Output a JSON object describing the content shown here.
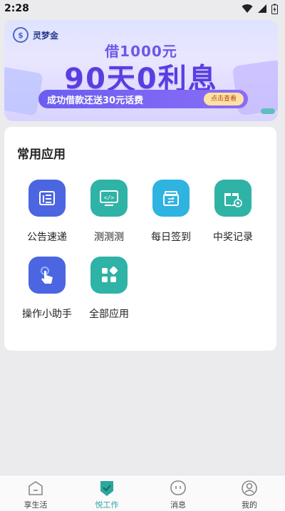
{
  "status_bar": {
    "time": "2:28"
  },
  "banner": {
    "brand": "灵梦金",
    "line1": "借1000元",
    "line2": "90天0利息",
    "promo_text": "成功借款还送30元话费",
    "promo_button": "点击查看"
  },
  "apps_section": {
    "title": "常用应用",
    "items": [
      {
        "label": "公告速递",
        "icon": "bulletin-icon",
        "color": "#4b66e0"
      },
      {
        "label": "测测测",
        "icon": "code-icon",
        "color": "#2fb3a6"
      },
      {
        "label": "每日签到",
        "icon": "checkin-box-icon",
        "color": "#2fb3e0"
      },
      {
        "label": "中奖记录",
        "icon": "gift-icon",
        "color": "#2fb3a6"
      },
      {
        "label": "操作小助手",
        "icon": "hand-pointer-icon",
        "color": "#4b66e0"
      },
      {
        "label": "全部应用",
        "icon": "grid-icon",
        "color": "#2fb3a6"
      }
    ]
  },
  "tabbar": {
    "items": [
      {
        "label": "享生活",
        "active": false
      },
      {
        "label": "悦工作",
        "active": true
      },
      {
        "label": "消息",
        "active": false
      },
      {
        "label": "我的",
        "active": false
      }
    ],
    "active_color": "#2aa89d"
  }
}
